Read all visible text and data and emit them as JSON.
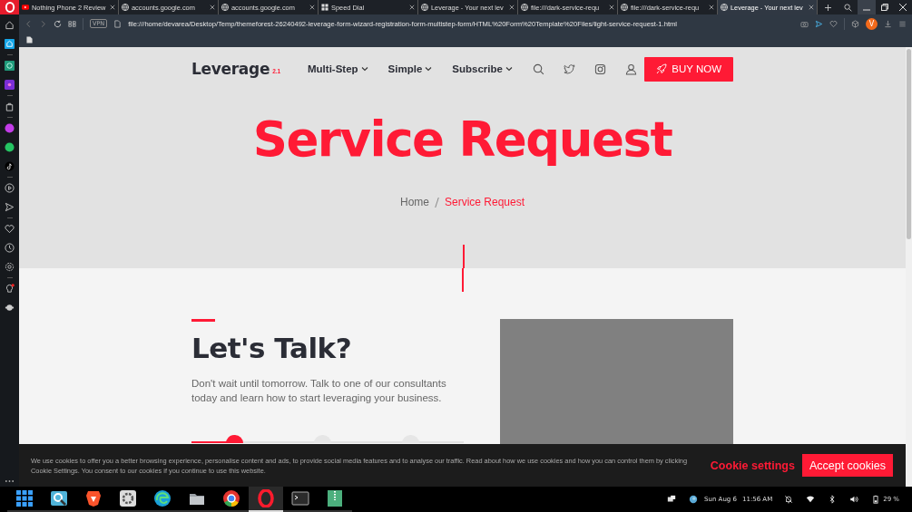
{
  "browser": {
    "tabs": [
      {
        "title": "Nothing Phone 2 Review",
        "kind": "video",
        "selected": false
      },
      {
        "title": "accounts.google.com",
        "kind": "globe",
        "selected": false
      },
      {
        "title": "accounts.google.com",
        "kind": "globe",
        "selected": false
      },
      {
        "title": "Speed Dial",
        "kind": "grid",
        "selected": false
      },
      {
        "title": "Leverage - Your next lev",
        "kind": "globe",
        "selected": false
      },
      {
        "title": "file:///dark-service-requ",
        "kind": "globe",
        "selected": false
      },
      {
        "title": "file:///dark-service-requ",
        "kind": "globe",
        "selected": false
      },
      {
        "title": "Leverage - Your next lev",
        "kind": "globe",
        "selected": true
      }
    ],
    "url": "file:///home/devarea/Desktop/Temp/themeforest-26240492-leverage-form-wizard-registration-form-multistep-form/HTML%20Form%20Template%20Files/light-service-request-1.html",
    "vpn": "VPN",
    "profile": "V"
  },
  "nav": {
    "logo": "Leverage",
    "version": "2.1",
    "menu": [
      "Multi-Step",
      "Simple",
      "Subscribe"
    ],
    "buy": "BUY NOW"
  },
  "hero": {
    "title": "Service Request",
    "breadcrumb": [
      {
        "label": "Home",
        "selected": false
      },
      {
        "label": "Service Request",
        "selected": true
      }
    ]
  },
  "intro": {
    "heading": "Let's Talk?",
    "text": "Don't wait until tomorrow. Talk to one of our consultants today and learn how to start leveraging your business.",
    "steps": [
      {
        "selected": true
      },
      {
        "selected": false
      },
      {
        "selected": false
      }
    ],
    "progress": {
      "level": 0.17
    }
  },
  "cookies": {
    "text": "We use cookies to offer you a better browsing experience, personalise content and ads, to provide social media features and to analyse our traffic. Read about how we use cookies and how you can control them by clicking Cookie Settings. You consent to our cookies if you continue to use this website.",
    "settings": "Cookie settings",
    "accept": "Accept cookies"
  },
  "taskbar": {
    "apps": [
      {
        "kind": "launcher",
        "selected": false
      },
      {
        "kind": "search",
        "selected": false
      },
      {
        "kind": "brave",
        "selected": false
      },
      {
        "kind": "settings",
        "selected": false
      },
      {
        "kind": "edge",
        "selected": false
      },
      {
        "kind": "files",
        "selected": false
      },
      {
        "kind": "chrome",
        "selected": false
      },
      {
        "kind": "opera",
        "selected": true
      },
      {
        "kind": "terminal",
        "selected": false
      },
      {
        "kind": "archive",
        "selected": false
      }
    ],
    "date": "Sun Aug 6",
    "time": "11:56 AM",
    "battery": "29 %"
  }
}
